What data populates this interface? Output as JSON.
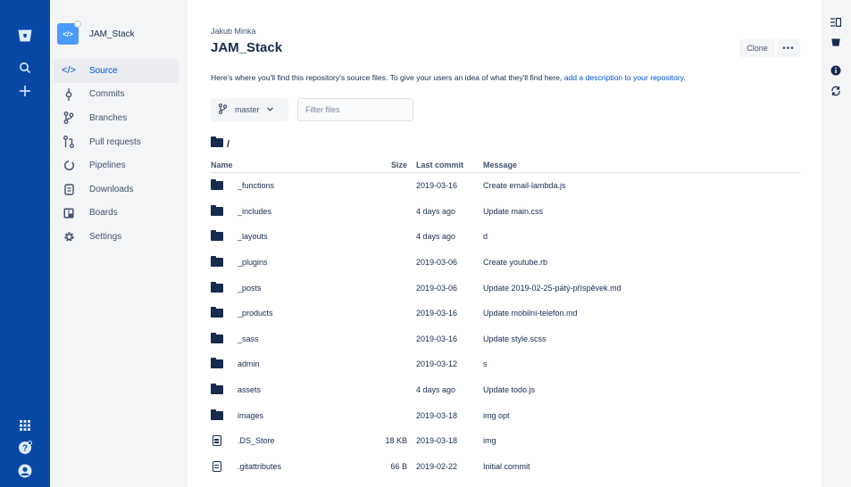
{
  "global_nav": {
    "icons": [
      "bitbucket-logo-icon",
      "search-icon",
      "create-plus-icon",
      "app-switcher-icon",
      "help-icon",
      "profile-avatar-icon"
    ]
  },
  "sidebar": {
    "repo_name": "JAM_Stack",
    "repo_avatar_glyph": "</>",
    "items": [
      {
        "label": "Source",
        "icon": "</>",
        "active": true
      },
      {
        "label": "Commits",
        "icon": "⬨"
      },
      {
        "label": "Branches",
        "icon": "ᛘ"
      },
      {
        "label": "Pull requests",
        "icon": "⇅"
      },
      {
        "label": "Pipelines",
        "icon": "↻"
      },
      {
        "label": "Downloads",
        "icon": "🗎"
      },
      {
        "label": "Boards",
        "icon": "▥"
      },
      {
        "label": "Settings",
        "icon": "⚙"
      }
    ]
  },
  "header": {
    "owner": "Jakub Minka",
    "title": "JAM_Stack",
    "clone_label": "Clone",
    "more_label": "•••"
  },
  "description": {
    "text": "Here's where you'll find this repository's source files. To give your users an idea of what they'll find here, ",
    "link": "add a description to your repository",
    "suffix": "."
  },
  "branch": {
    "name": "master"
  },
  "filter": {
    "placeholder": "Filter files"
  },
  "path": "/",
  "table": {
    "headers": {
      "name": "Name",
      "size": "Size",
      "last_commit": "Last commit",
      "message": "Message"
    },
    "rows": [
      {
        "type": "folder",
        "name": "_functions",
        "size": "",
        "date": "2019-03-16",
        "message": "Create email-lambda.js"
      },
      {
        "type": "folder",
        "name": "_includes",
        "size": "",
        "date": "4 days ago",
        "message": "Update main.css"
      },
      {
        "type": "folder",
        "name": "_layouts",
        "size": "",
        "date": "4 days ago",
        "message": "d"
      },
      {
        "type": "folder",
        "name": "_plugins",
        "size": "",
        "date": "2019-03-06",
        "message": "Create youtube.rb"
      },
      {
        "type": "folder",
        "name": "_posts",
        "size": "",
        "date": "2019-03-06",
        "message": "Update 2019-02-25-pátý-příspěvek.md"
      },
      {
        "type": "folder",
        "name": "_products",
        "size": "",
        "date": "2019-03-16",
        "message": "Update mobilní-telefon.md"
      },
      {
        "type": "folder",
        "name": "_sass",
        "size": "",
        "date": "2019-03-16",
        "message": "Update style.scss"
      },
      {
        "type": "folder",
        "name": "admin",
        "size": "",
        "date": "2019-03-12",
        "message": "s"
      },
      {
        "type": "folder",
        "name": "assets",
        "size": "",
        "date": "4 days ago",
        "message": "Update todo.js"
      },
      {
        "type": "folder",
        "name": "images",
        "size": "",
        "date": "2019-03-18",
        "message": "img opt"
      },
      {
        "type": "file",
        "name": ".DS_Store",
        "size": "18 KB",
        "date": "2019-03-18",
        "message": "img"
      },
      {
        "type": "file",
        "name": ".gitattributes",
        "size": "66 B",
        "date": "2019-02-22",
        "message": "Initial commit"
      }
    ]
  },
  "right_bar": {
    "icons": [
      "toggle-panel-icon",
      "bitbucket-small-icon",
      "info-icon",
      "sync-icon"
    ]
  },
  "colors": {
    "nav_bg": "#0747a6",
    "link": "#0052cc",
    "text": "#172b4d"
  }
}
